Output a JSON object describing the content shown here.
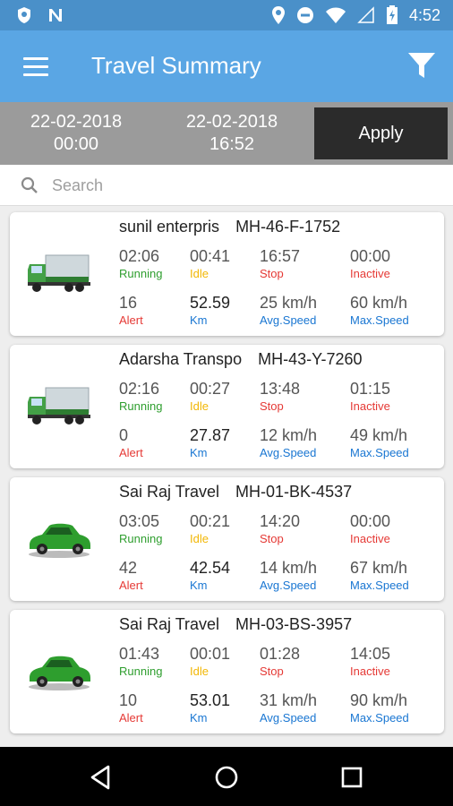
{
  "status_bar": {
    "time": "4:52"
  },
  "app_bar": {
    "title": "Travel Summary"
  },
  "date_filter": {
    "from_date": "22-02-2018",
    "from_time": "00:00",
    "to_date": "22-02-2018",
    "to_time": "16:52",
    "apply_label": "Apply"
  },
  "search": {
    "placeholder": "Search"
  },
  "label_colors": {
    "running": "#2e9e2e",
    "idle": "#f2b705",
    "stop": "#e53935",
    "inactive": "#e53935",
    "alert": "#e53935",
    "km": "#1976d2",
    "avg_speed": "#1976d2",
    "max_speed": "#1976d2"
  },
  "labels": {
    "running": "Running",
    "idle": "Idle",
    "stop": "Stop",
    "inactive": "Inactive",
    "alert": "Alert",
    "km": "Km",
    "avg_speed": "Avg.Speed",
    "max_speed": "Max.Speed"
  },
  "vehicles": [
    {
      "name": "sunil enterpris",
      "plate": "MH-46-F-1752",
      "icon": "truck-icon",
      "running": "02:06",
      "idle": "00:41",
      "stop": "16:57",
      "inactive": "00:00",
      "alert": "16",
      "km": "52.59",
      "avg_speed": "25 km/h",
      "max_speed": "60 km/h"
    },
    {
      "name": "Adarsha Transpo",
      "plate": "MH-43-Y-7260",
      "icon": "truck-icon",
      "running": "02:16",
      "idle": "00:27",
      "stop": "13:48",
      "inactive": "01:15",
      "alert": "0",
      "km": "27.87",
      "avg_speed": "12 km/h",
      "max_speed": "49 km/h"
    },
    {
      "name": "Sai Raj Travel",
      "plate": "MH-01-BK-4537",
      "icon": "car-icon",
      "running": "03:05",
      "idle": "00:21",
      "stop": "14:20",
      "inactive": "00:00",
      "alert": "42",
      "km": "42.54",
      "avg_speed": "14 km/h",
      "max_speed": "67 km/h"
    },
    {
      "name": "Sai Raj Travel",
      "plate": "MH-03-BS-3957",
      "icon": "car-icon",
      "running": "01:43",
      "idle": "00:01",
      "stop": "01:28",
      "inactive": "14:05",
      "alert": "10",
      "km": "53.01",
      "avg_speed": "31 km/h",
      "max_speed": "90 km/h"
    }
  ]
}
